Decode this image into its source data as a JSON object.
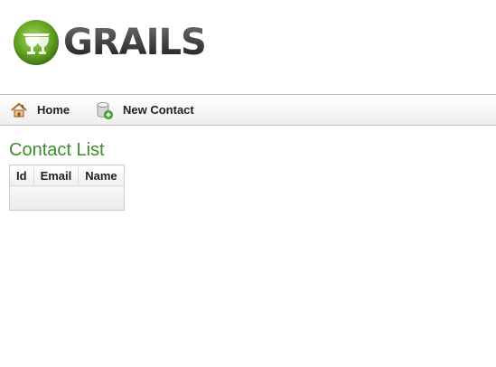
{
  "logo": {
    "text": "GRAILS"
  },
  "nav": {
    "home_label": "Home",
    "new_contact_label": "New Contact",
    "home_icon": "house-icon",
    "new_contact_icon": "database-add-icon"
  },
  "page": {
    "title": "Contact List"
  },
  "table": {
    "columns": [
      "Id",
      "Email",
      "Name"
    ],
    "rows": []
  },
  "colors": {
    "title_green": "#3a8f2a",
    "logo_green": "#6aa525"
  }
}
